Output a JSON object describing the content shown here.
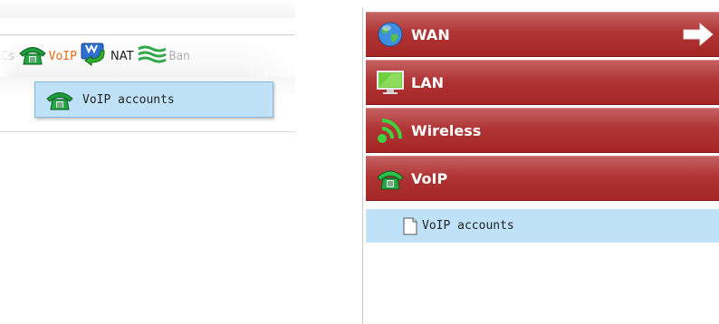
{
  "topmenu": {
    "items": [
      {
        "label": "Cs",
        "icon": "partial-icon",
        "state": "faded"
      },
      {
        "label": "VoIP",
        "icon": "voip-phone-icon",
        "state": "active"
      },
      {
        "label": "NAT",
        "icon": "nat-icon",
        "state": "normal"
      },
      {
        "label": "Ban",
        "icon": "bandwidth-icon",
        "state": "faded"
      }
    ],
    "submenu": {
      "label": "VoIP accounts",
      "icon": "voip-phone-icon"
    }
  },
  "sidebar": {
    "sections": [
      {
        "label": "WAN",
        "icon": "globe-icon",
        "arrow": true
      },
      {
        "label": "LAN",
        "icon": "monitor-icon",
        "arrow": false
      },
      {
        "label": "Wireless",
        "icon": "wireless-icon",
        "arrow": false
      },
      {
        "label": "VoIP",
        "icon": "voip-phone-icon",
        "arrow": false
      }
    ],
    "subitem": {
      "label": "VoIP accounts",
      "icon": "document-icon"
    }
  },
  "colors": {
    "section_red": "#b13535",
    "highlight_blue": "#bfe2f8",
    "active_orange": "#e96a15"
  }
}
